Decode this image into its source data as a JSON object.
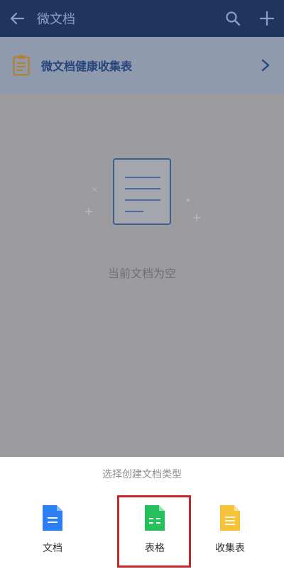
{
  "appbar": {
    "title": "微文档",
    "back_icon": "arrow-left-icon",
    "search_icon": "search-icon",
    "add_icon": "plus-icon"
  },
  "banner": {
    "label": "微文档健康收集表",
    "icon": "clipboard-icon",
    "chevron_icon": "chevron-right-icon"
  },
  "empty_state": {
    "text": "当前文档为空",
    "icon": "document-icon"
  },
  "sheet": {
    "title": "选择创建文档类型",
    "options": [
      {
        "label": "文档",
        "icon": "doc-file-icon",
        "color": "#2c7ff3"
      },
      {
        "label": "表格",
        "icon": "sheet-file-icon",
        "color": "#26c15d"
      },
      {
        "label": "收集表",
        "icon": "form-file-icon",
        "color": "#f6c23a"
      }
    ]
  },
  "colors": {
    "appbar_bg": "#1f355f",
    "banner_bg": "#8f9aac",
    "overlay_bg": "#9c9c9f",
    "highlight": "#c8262b"
  }
}
